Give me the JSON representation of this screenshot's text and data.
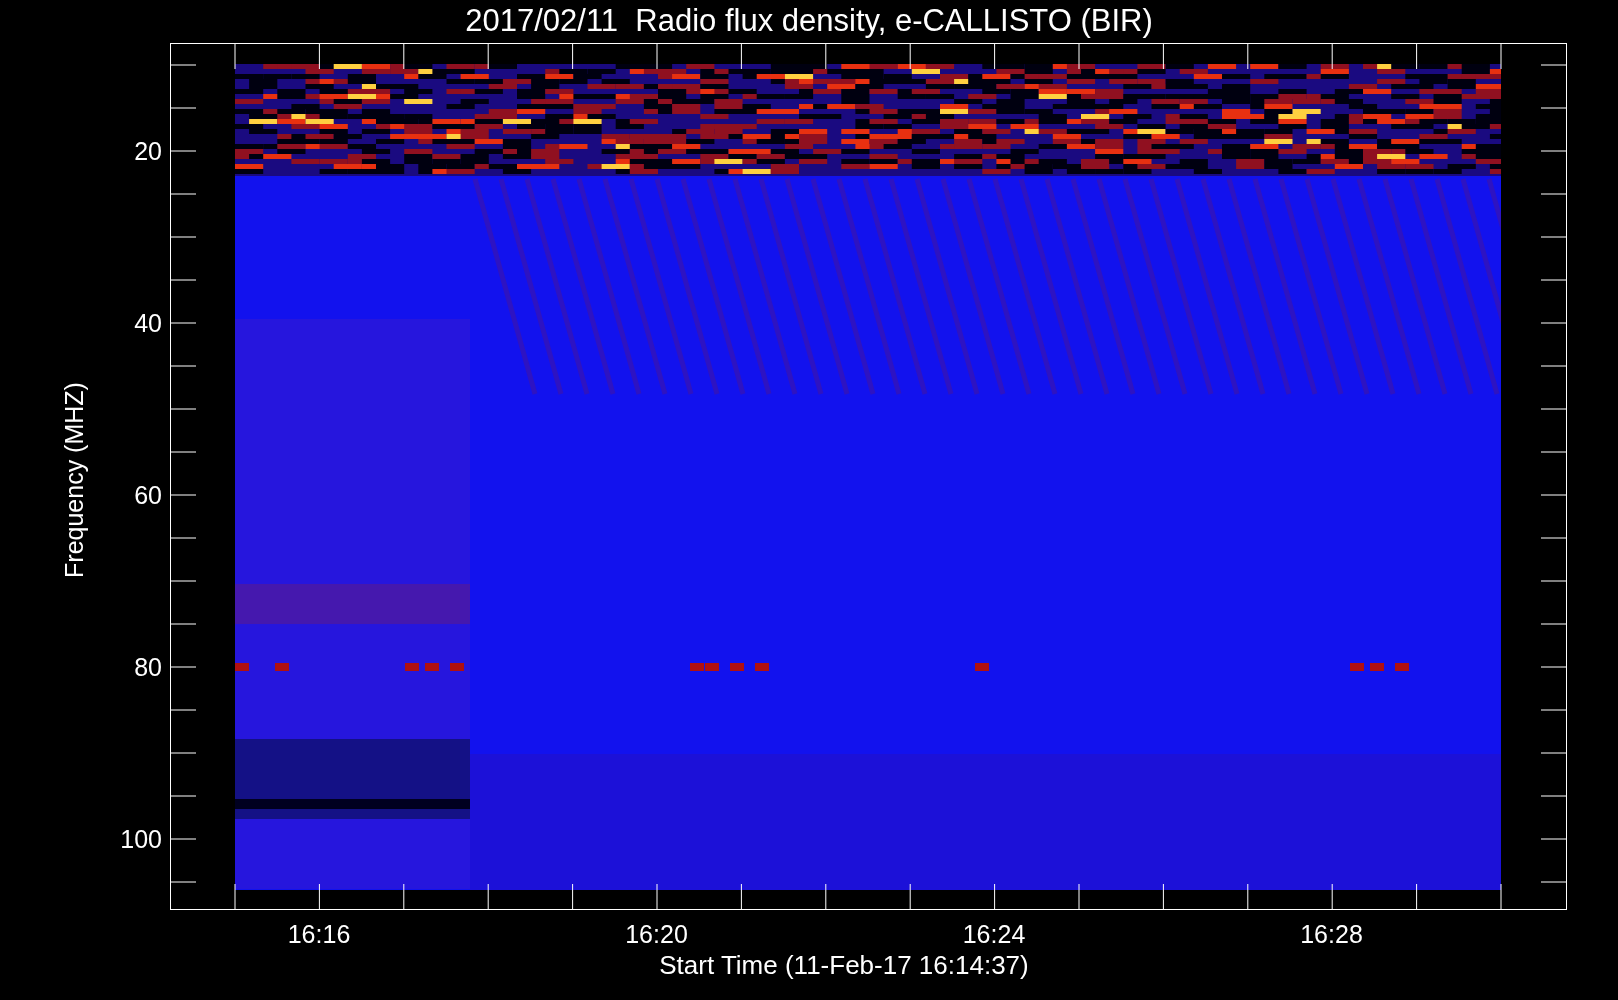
{
  "title": "2017/02/11  Radio flux density, e-CALLISTO (BIR)",
  "y_axis": {
    "label": "Frequency (MHZ)",
    "ticks": [
      "20",
      "40",
      "60",
      "80",
      "100"
    ]
  },
  "x_axis": {
    "label": "Start Time (11-Feb-17 16:14:37)",
    "ticks": [
      "16:16",
      "16:20",
      "16:24",
      "16:28"
    ]
  }
}
